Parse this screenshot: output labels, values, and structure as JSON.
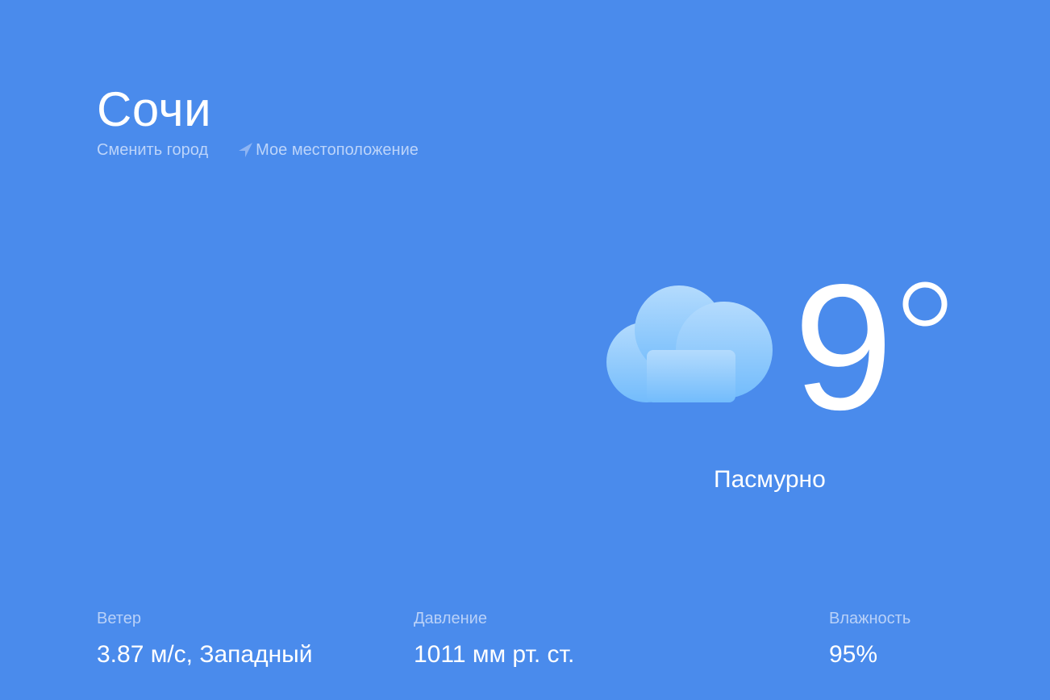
{
  "header": {
    "city": "Сочи",
    "change_city_label": "Сменить город",
    "my_location_label": "Мое местоположение",
    "location_icon": "navigation-arrow-icon"
  },
  "current": {
    "temperature": "9",
    "degree_icon": "degree-icon",
    "condition": "Пасмурно",
    "weather_icon": "cloud-icon"
  },
  "details": {
    "wind": {
      "label": "Ветер",
      "value": "3.87 м/с, Западный"
    },
    "pressure": {
      "label": "Давление",
      "value": "1011 мм рт. ст."
    },
    "humidity": {
      "label": "Влажность",
      "value": "95%"
    }
  },
  "colors": {
    "background": "#4a8bec",
    "text": "#ffffff",
    "muted_text": "#bcd4fa",
    "cloud_top": "#b4dbfd",
    "cloud_bottom": "#73bcfc"
  }
}
